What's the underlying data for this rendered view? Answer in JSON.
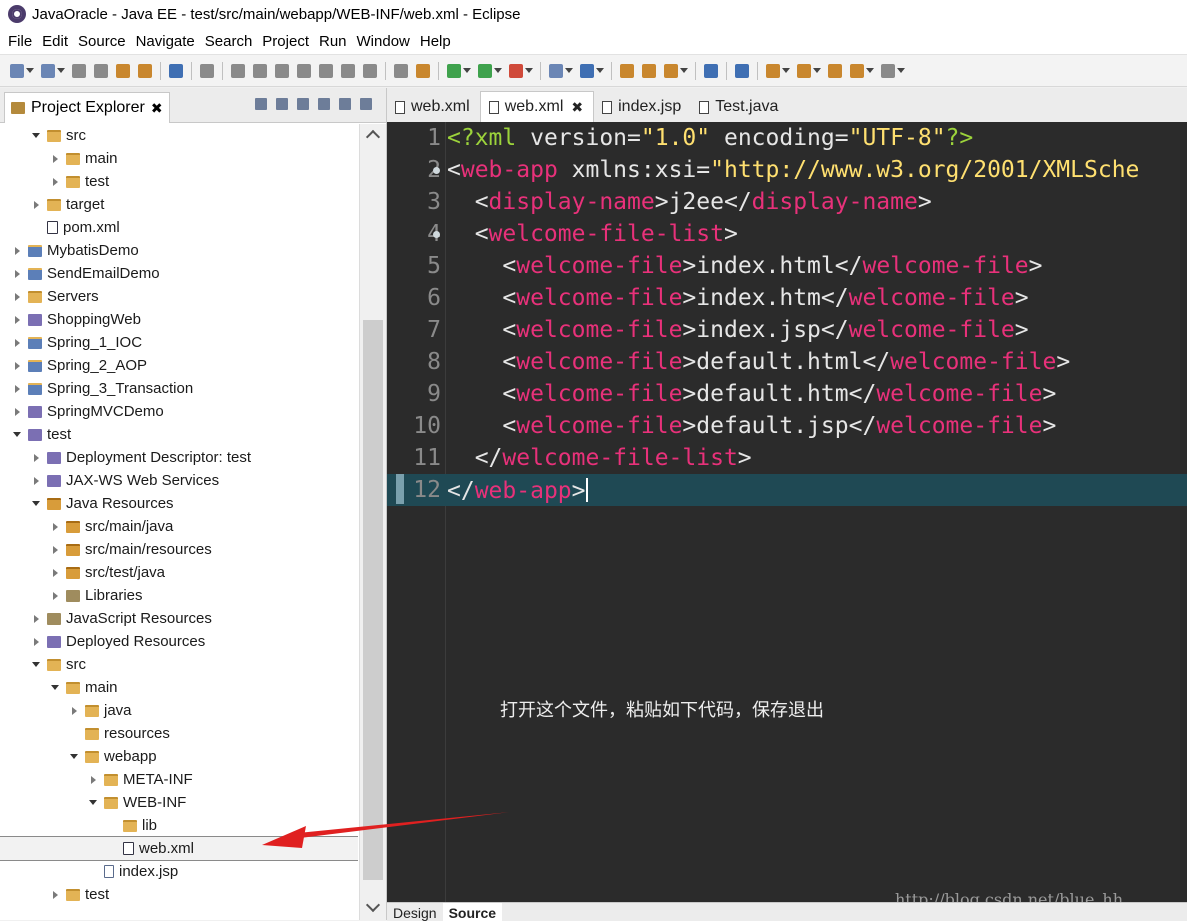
{
  "window": {
    "title": "JavaOracle - Java EE - test/src/main/webapp/WEB-INF/web.xml - Eclipse"
  },
  "menu": [
    "File",
    "Edit",
    "Source",
    "Navigate",
    "Search",
    "Project",
    "Run",
    "Window",
    "Help"
  ],
  "explorer": {
    "tab_label": "Project Explorer",
    "close_glyph": "✖",
    "rows": [
      {
        "label": "src",
        "depth": 1,
        "twisty": "open",
        "icon": "folder"
      },
      {
        "label": "main",
        "depth": 2,
        "twisty": "closed",
        "icon": "folder"
      },
      {
        "label": "test",
        "depth": 2,
        "twisty": "closed",
        "icon": "folder"
      },
      {
        "label": "target",
        "depth": 1,
        "twisty": "closed",
        "icon": "folder"
      },
      {
        "label": "pom.xml",
        "depth": 1,
        "twisty": "none",
        "icon": "xml"
      },
      {
        "label": "MybatisDemo",
        "depth": 0,
        "twisty": "closed",
        "icon": "proj"
      },
      {
        "label": "SendEmailDemo",
        "depth": 0,
        "twisty": "closed",
        "icon": "proj"
      },
      {
        "label": "Servers",
        "depth": 0,
        "twisty": "closed",
        "icon": "folder"
      },
      {
        "label": "ShoppingWeb",
        "depth": 0,
        "twisty": "closed",
        "icon": "web"
      },
      {
        "label": "Spring_1_IOC",
        "depth": 0,
        "twisty": "closed",
        "icon": "proj"
      },
      {
        "label": "Spring_2_AOP",
        "depth": 0,
        "twisty": "closed",
        "icon": "proj"
      },
      {
        "label": "Spring_3_Transaction",
        "depth": 0,
        "twisty": "closed",
        "icon": "proj"
      },
      {
        "label": "SpringMVCDemo",
        "depth": 0,
        "twisty": "closed",
        "icon": "web"
      },
      {
        "label": "test",
        "depth": 0,
        "twisty": "open",
        "icon": "web"
      },
      {
        "label": "Deployment Descriptor: test",
        "depth": 1,
        "twisty": "closed",
        "icon": "web"
      },
      {
        "label": "JAX-WS Web Services",
        "depth": 1,
        "twisty": "closed",
        "icon": "web"
      },
      {
        "label": "Java Resources",
        "depth": 1,
        "twisty": "open",
        "icon": "pkg"
      },
      {
        "label": "src/main/java",
        "depth": 2,
        "twisty": "closed",
        "icon": "pkg"
      },
      {
        "label": "src/main/resources",
        "depth": 2,
        "twisty": "closed",
        "icon": "pkg"
      },
      {
        "label": "src/test/java",
        "depth": 2,
        "twisty": "closed",
        "icon": "pkg"
      },
      {
        "label": "Libraries",
        "depth": 2,
        "twisty": "closed",
        "icon": "lib"
      },
      {
        "label": "JavaScript Resources",
        "depth": 1,
        "twisty": "closed",
        "icon": "lib"
      },
      {
        "label": "Deployed Resources",
        "depth": 1,
        "twisty": "closed",
        "icon": "web"
      },
      {
        "label": "src",
        "depth": 1,
        "twisty": "open",
        "icon": "folder"
      },
      {
        "label": "main",
        "depth": 2,
        "twisty": "open",
        "icon": "folder"
      },
      {
        "label": "java",
        "depth": 3,
        "twisty": "closed",
        "icon": "folder"
      },
      {
        "label": "resources",
        "depth": 3,
        "twisty": "none",
        "icon": "folder"
      },
      {
        "label": "webapp",
        "depth": 3,
        "twisty": "open",
        "icon": "folder"
      },
      {
        "label": "META-INF",
        "depth": 4,
        "twisty": "closed",
        "icon": "folder"
      },
      {
        "label": "WEB-INF",
        "depth": 4,
        "twisty": "open",
        "icon": "folder"
      },
      {
        "label": "lib",
        "depth": 5,
        "twisty": "none",
        "icon": "folder"
      },
      {
        "label": "web.xml",
        "depth": 5,
        "twisty": "none",
        "icon": "xml",
        "selected": true
      },
      {
        "label": "index.jsp",
        "depth": 4,
        "twisty": "none",
        "icon": "file"
      },
      {
        "label": "test",
        "depth": 2,
        "twisty": "closed",
        "icon": "folder"
      }
    ]
  },
  "editor": {
    "tabs": [
      {
        "label": "web.xml",
        "active": false,
        "close": ""
      },
      {
        "label": "web.xml",
        "active": true,
        "close": "✖"
      },
      {
        "label": "index.jsp",
        "active": false,
        "close": ""
      },
      {
        "label": "Test.java",
        "active": false,
        "close": ""
      }
    ],
    "lines": [
      {
        "n": "1",
        "fold": false,
        "tokens": [
          [
            "pi",
            "<?xml "
          ],
          [
            "p",
            "version="
          ],
          [
            "s",
            "\"1.0\""
          ],
          [
            "p",
            " encoding="
          ],
          [
            "s",
            "\"UTF-8\""
          ],
          [
            "pi",
            "?>"
          ]
        ]
      },
      {
        "n": "2",
        "fold": true,
        "tokens": [
          [
            "p",
            "<"
          ],
          [
            "t",
            "web-app"
          ],
          [
            "p",
            " xmlns:xsi="
          ],
          [
            "s",
            "\"http://www.w3.org/2001/XMLSche"
          ]
        ]
      },
      {
        "n": "3",
        "fold": false,
        "tokens": [
          [
            "p",
            "  <"
          ],
          [
            "t",
            "display-name"
          ],
          [
            "p",
            ">"
          ],
          [
            "txt",
            "j2ee"
          ],
          [
            "p",
            "</"
          ],
          [
            "t",
            "display-name"
          ],
          [
            "p",
            ">"
          ]
        ]
      },
      {
        "n": "4",
        "fold": true,
        "tokens": [
          [
            "p",
            "  <"
          ],
          [
            "t",
            "welcome-file-list"
          ],
          [
            "p",
            ">"
          ]
        ]
      },
      {
        "n": "5",
        "fold": false,
        "tokens": [
          [
            "p",
            "    <"
          ],
          [
            "t",
            "welcome-file"
          ],
          [
            "p",
            ">"
          ],
          [
            "txt",
            "index.html"
          ],
          [
            "p",
            "</"
          ],
          [
            "t",
            "welcome-file"
          ],
          [
            "p",
            ">"
          ]
        ]
      },
      {
        "n": "6",
        "fold": false,
        "tokens": [
          [
            "p",
            "    <"
          ],
          [
            "t",
            "welcome-file"
          ],
          [
            "p",
            ">"
          ],
          [
            "txt",
            "index.htm"
          ],
          [
            "p",
            "</"
          ],
          [
            "t",
            "welcome-file"
          ],
          [
            "p",
            ">"
          ]
        ]
      },
      {
        "n": "7",
        "fold": false,
        "tokens": [
          [
            "p",
            "    <"
          ],
          [
            "t",
            "welcome-file"
          ],
          [
            "p",
            ">"
          ],
          [
            "txt",
            "index.jsp"
          ],
          [
            "p",
            "</"
          ],
          [
            "t",
            "welcome-file"
          ],
          [
            "p",
            ">"
          ]
        ]
      },
      {
        "n": "8",
        "fold": false,
        "tokens": [
          [
            "p",
            "    <"
          ],
          [
            "t",
            "welcome-file"
          ],
          [
            "p",
            ">"
          ],
          [
            "txt",
            "default.html"
          ],
          [
            "p",
            "</"
          ],
          [
            "t",
            "welcome-file"
          ],
          [
            "p",
            ">"
          ]
        ]
      },
      {
        "n": "9",
        "fold": false,
        "tokens": [
          [
            "p",
            "    <"
          ],
          [
            "t",
            "welcome-file"
          ],
          [
            "p",
            ">"
          ],
          [
            "txt",
            "default.htm"
          ],
          [
            "p",
            "</"
          ],
          [
            "t",
            "welcome-file"
          ],
          [
            "p",
            ">"
          ]
        ]
      },
      {
        "n": "10",
        "fold": false,
        "tokens": [
          [
            "p",
            "    <"
          ],
          [
            "t",
            "welcome-file"
          ],
          [
            "p",
            ">"
          ],
          [
            "txt",
            "default.jsp"
          ],
          [
            "p",
            "</"
          ],
          [
            "t",
            "welcome-file"
          ],
          [
            "p",
            ">"
          ]
        ]
      },
      {
        "n": "11",
        "fold": false,
        "tokens": [
          [
            "p",
            "  </"
          ],
          [
            "t",
            "welcome-file-list"
          ],
          [
            "p",
            ">"
          ]
        ]
      },
      {
        "n": "12",
        "fold": false,
        "current": true,
        "tokens": [
          [
            "p",
            "</"
          ],
          [
            "t",
            "web-app"
          ],
          [
            "p",
            ">"
          ]
        ]
      }
    ],
    "annotation": "打开这个文件，粘贴如下代码，保存退出",
    "watermark": "http://blog.csdn.net/blue_hh",
    "bottom_tabs": [
      {
        "label": "Design",
        "active": false
      },
      {
        "label": "Source",
        "active": true
      }
    ]
  }
}
